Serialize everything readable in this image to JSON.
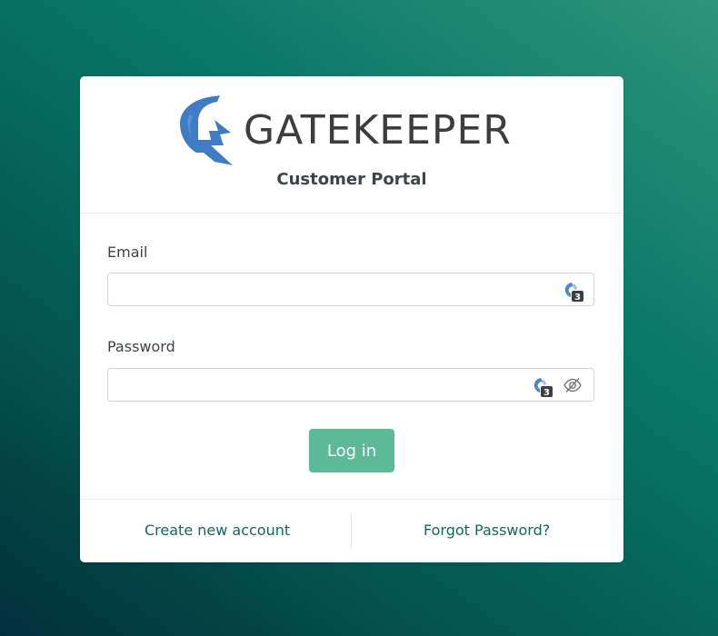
{
  "brand": {
    "name": "GATEKEEPER",
    "logo_icon": "spartan-helmet-icon",
    "logo_color": "#3f7cc4",
    "accent_color": "#5dba99"
  },
  "header": {
    "subtitle": "Customer Portal"
  },
  "form": {
    "email": {
      "label": "Email",
      "value": "",
      "autofill_badge": "3"
    },
    "password": {
      "label": "Password",
      "value": "",
      "autofill_badge": "3",
      "toggle_icon": "eye-slash-icon"
    },
    "submit_label": "Log in"
  },
  "footer": {
    "create_account": "Create new account",
    "forgot_password": "Forgot Password?"
  }
}
